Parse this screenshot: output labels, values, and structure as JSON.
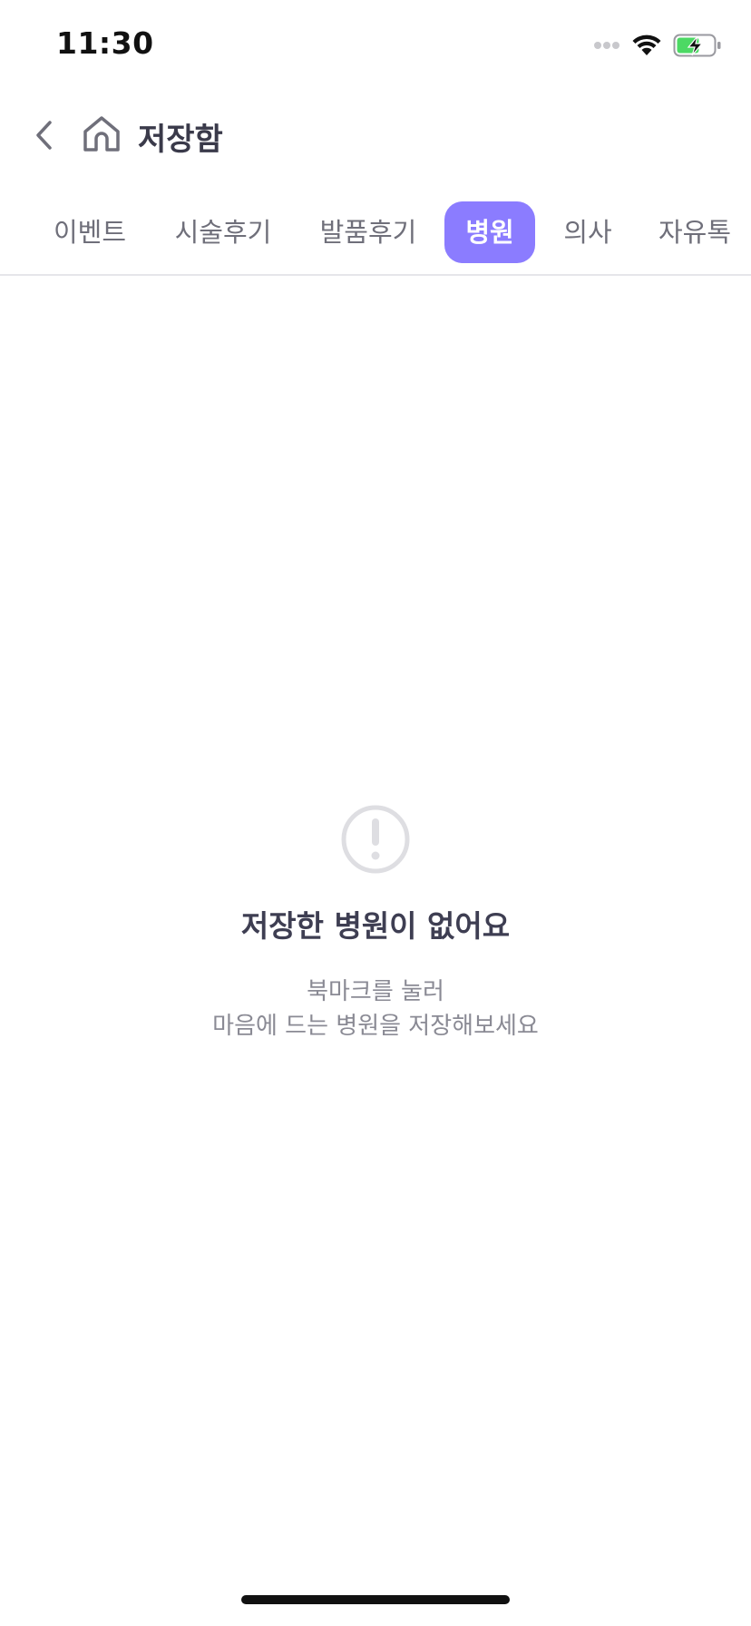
{
  "status_bar": {
    "time": "11:30",
    "icons": [
      "signal-dots-icon",
      "wifi-icon",
      "battery-charging-icon"
    ]
  },
  "header": {
    "back_icon": "chevron-left-icon",
    "home_icon": "home-icon",
    "title": "저장함"
  },
  "tabs": {
    "items": [
      {
        "label": "이벤트"
      },
      {
        "label": "시술후기"
      },
      {
        "label": "발품후기"
      },
      {
        "label": "병원"
      },
      {
        "label": "의사"
      },
      {
        "label": "자유톡"
      }
    ],
    "active_index": 3
  },
  "empty_state": {
    "icon": "exclamation-circle-icon",
    "title": "저장한 병원이 없어요",
    "description_line1": "북마크를 눌러",
    "description_line2": "마음에 드는 병원을 저장해보세요"
  },
  "colors": {
    "accent": "#8b7cff",
    "title_text": "#3e3e52",
    "muted_text": "#8a8a94",
    "tab_text": "#6f6f7a",
    "battery_green": "#4cd964"
  }
}
